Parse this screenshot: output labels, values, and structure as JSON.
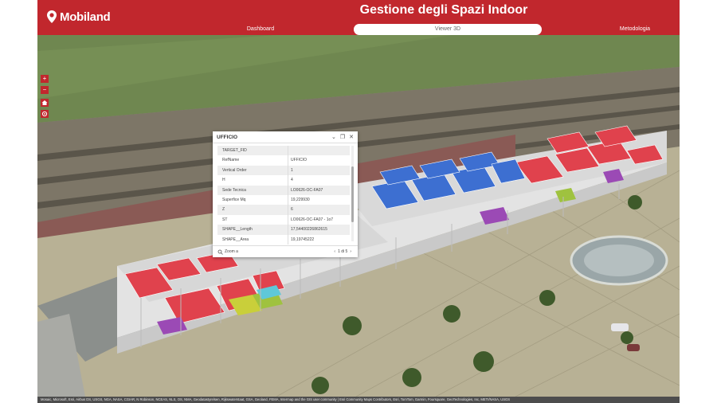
{
  "app": {
    "logo_text": "Mobiland",
    "title": "Gestione degli Spazi Indoor",
    "tabs": [
      {
        "label": "Dashboard",
        "active": false
      },
      {
        "label": "Viewer 3D",
        "active": true
      },
      {
        "label": "Metodologia",
        "active": false
      }
    ],
    "brand_color": "#c1272d"
  },
  "map_controls": {
    "zoom_in": "+",
    "zoom_out": "−",
    "home_icon": "home-icon",
    "compass_icon": "compass-icon"
  },
  "popup": {
    "title": "UFFICIO",
    "rows": [
      {
        "key": "TARGET_FID",
        "value": ""
      },
      {
        "key": "RefName",
        "value": "UFFICIO"
      },
      {
        "key": "Vertical Order",
        "value": "1"
      },
      {
        "key": "H",
        "value": "4"
      },
      {
        "key": "Sede Tecnica",
        "value": "LO0626-OC-FA07"
      },
      {
        "key": "Superfice Mq",
        "value": "19,229930"
      },
      {
        "key": "Z",
        "value": "6"
      },
      {
        "key": "ST",
        "value": "LO0626-OC-FA07 - 1o7"
      },
      {
        "key": "SHAPE__Length",
        "value": "17,54400226862615"
      },
      {
        "key": "SHAPE__Area",
        "value": "19,19745222"
      }
    ],
    "zoom_label": "Zoom a",
    "pager": "1 di 5"
  },
  "attribution": "Mosaic, Microsoft, Esri, Airbus DS, USGS, NGA, NASA, CGIAR, N Robinson, NCEAS, NLS, OS, NMA, Geodatastyrelsen, Rijkswaterstaat, GSA, Geoland, FEMA, Intermap and the GIS user community | Esri Community Maps Contributors, Esri, TomTom, Garmin, Foursquare, GeoTechnologies, Inc, METI/NASA, USGS"
}
